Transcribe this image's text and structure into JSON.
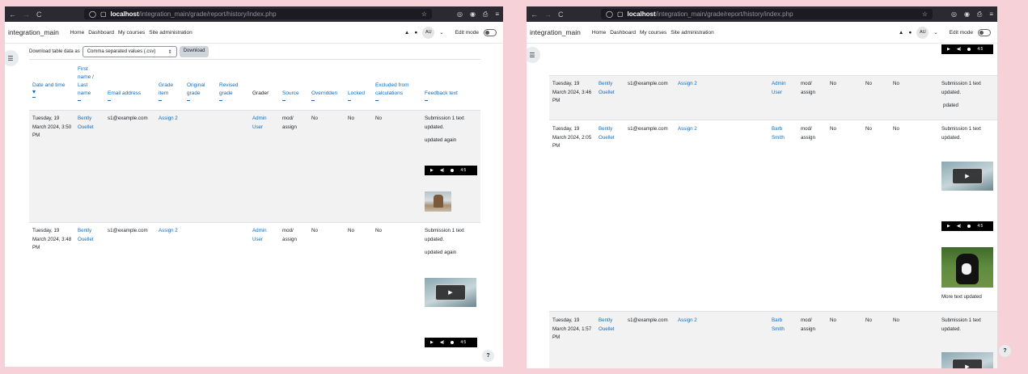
{
  "browser": {
    "host": "localhost",
    "path": "/integration_main/grade/report/history/index.php"
  },
  "site": {
    "brand": "integration_main",
    "menu": [
      "Home",
      "Dashboard",
      "My courses",
      "Site administration"
    ],
    "avatar": "AU",
    "edit_mode": "Edit mode"
  },
  "download": {
    "label": "Download table data as",
    "format": "Comma separated values (.csv)",
    "button": "Download"
  },
  "columns": {
    "date": "Date and time",
    "firstname": "First name / Last name",
    "email": "Email address",
    "grade_item": "Grade item",
    "original": "Original grade",
    "revised": "Revised grade",
    "grader": "Grader",
    "source": "Source",
    "overridden": "Overridden",
    "locked": "Locked",
    "excluded": "Excluded from calculations",
    "feedback": "Feedback text"
  },
  "left_rows": [
    {
      "date": "Tuesday, 19 March 2024, 3:50 PM",
      "name": "Bently Ouellet",
      "email": "s1@example.com",
      "item": "Assign 2",
      "grader": "Admin User",
      "source": "mod/ assign",
      "overridden": "No",
      "locked": "No",
      "excluded": "No",
      "feedback1": "Submission 1 text updated.",
      "feedback2": "updated again",
      "audio_time": "4:5"
    },
    {
      "date": "Tuesday, 19 March 2024, 3:48 PM",
      "name": "Bently Ouellet",
      "email": "s1@example.com",
      "item": "Assign 2",
      "grader": "Admin User",
      "source": "mod/ assign",
      "overridden": "No",
      "locked": "No",
      "excluded": "No",
      "feedback1": "Submission 1 text updated.",
      "feedback2": "updated again",
      "audio_time": "4:5"
    }
  ],
  "right_top_audio_time": "4:5",
  "right_rows": [
    {
      "date": "Tuesday, 19 March 2024, 3:46 PM",
      "name": "Bently Ouellet",
      "email": "s1@example.com",
      "item": "Assign 2",
      "grader": "Admin User",
      "source": "mod/ assign",
      "overridden": "No",
      "locked": "No",
      "excluded": "No",
      "feedback1": "Submission 1 text updated.",
      "feedback2": "pdated"
    },
    {
      "date": "Tuesday, 19 March 2024, 2:05 PM",
      "name": "Bently Ouellet",
      "email": "s1@example.com",
      "item": "Assign 2",
      "grader": "Barb Smith",
      "source": "mod/ assign",
      "overridden": "No",
      "locked": "No",
      "excluded": "No",
      "feedback1": "Submission 1 text updated.",
      "feedback2": "More text updated",
      "audio_time": "4:5"
    },
    {
      "date": "Tuesday, 19 March 2024, 1:57 PM",
      "name": "Bently Ouellet",
      "email": "s1@example.com",
      "item": "Assign 2",
      "grader": "Barb Smith",
      "source": "mod/ assign",
      "overridden": "No",
      "locked": "No",
      "excluded": "No",
      "feedback1": "Submission 1 text updated."
    }
  ],
  "icons": {
    "back": "←",
    "forward": "→",
    "reload": "C",
    "shield": "◯",
    "page": "▢",
    "star": "☆",
    "pocket": "◎",
    "account": "◉",
    "extensions": "⎙",
    "menu": "≡",
    "bell": "▲",
    "chat": "●",
    "chevron": "⌄",
    "drawer": "☰",
    "help": "?",
    "play": "▶",
    "volume": "◀)",
    "sort_desc": "▾",
    "select_arrow": "⇕"
  }
}
